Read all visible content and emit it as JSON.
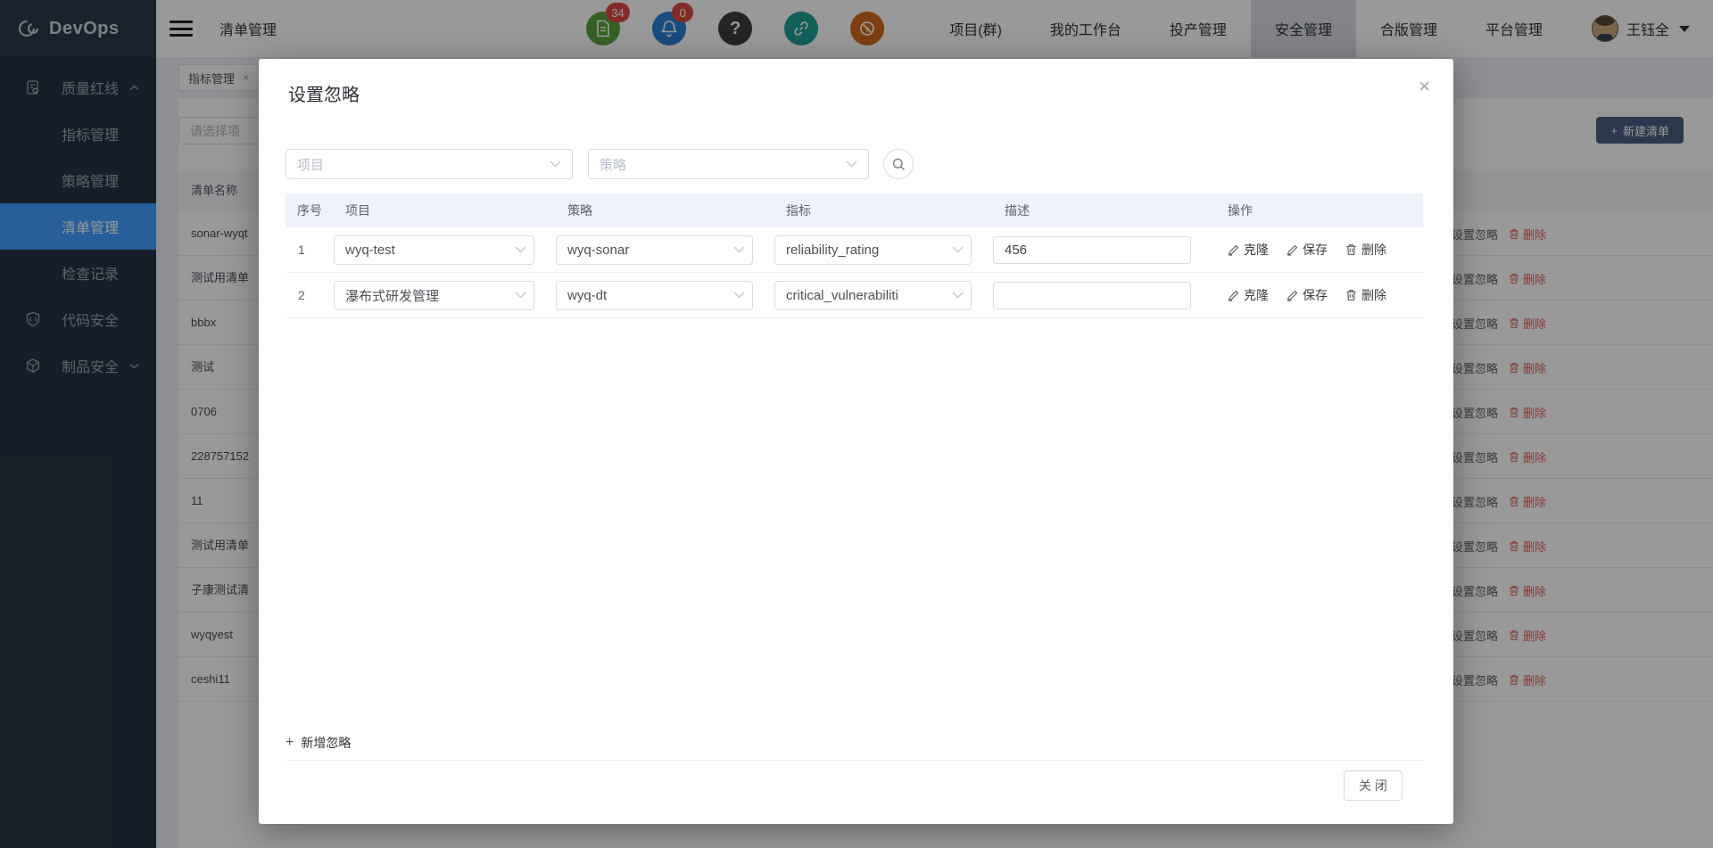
{
  "app": {
    "logo_text": "DevOps"
  },
  "icons": {
    "close": "×",
    "plus": "+",
    "help": "?"
  },
  "colors": {
    "accent_blue": "#409eff",
    "sidebar_bg": "#263345",
    "delete_red": "#f56c6c",
    "badge_red": "#d94a42",
    "icon_green": "#5ba23c",
    "icon_blue": "#2a7fd4",
    "icon_teal": "#1f9e96",
    "icon_orange": "#d2691e",
    "new_button_navy": "#485e80",
    "modal_table_header_bg": "#eef2fb"
  },
  "sidebar": {
    "items": [
      {
        "label": "质量红线"
      },
      {
        "label": "指标管理"
      },
      {
        "label": "策略管理"
      },
      {
        "label": "清单管理"
      },
      {
        "label": "检查记录"
      },
      {
        "label": "代码安全"
      },
      {
        "label": "制品安全"
      }
    ]
  },
  "header": {
    "page_title": "清单管理",
    "doc_badge": "34",
    "bell_badge": "0",
    "nav": [
      {
        "label": "项目(群)"
      },
      {
        "label": "我的工作台"
      },
      {
        "label": "投产管理"
      },
      {
        "label": "安全管理"
      },
      {
        "label": "合版管理"
      },
      {
        "label": "平台管理"
      }
    ],
    "user_name": "王钰全"
  },
  "page": {
    "tab_label": "指标管理",
    "search_placeholder": "请选择项",
    "new_list_button": "新建清单",
    "list_header": "清单名称",
    "rows": [
      {
        "name": "sonar-wyqt"
      },
      {
        "name": "测试用清单"
      },
      {
        "name": "bbbx"
      },
      {
        "name": "测试"
      },
      {
        "name": "0706"
      },
      {
        "name": "228757152"
      },
      {
        "name": "11"
      },
      {
        "name": "测试用清单"
      },
      {
        "name": "子康测试清"
      },
      {
        "name": "wyqyest"
      },
      {
        "name": "ceshi11"
      }
    ],
    "row_action_ignore": "设置忽略",
    "row_action_delete": "删除"
  },
  "modal": {
    "title": "设置忽略",
    "project_filter_placeholder": "项目",
    "policy_filter_placeholder": "策略",
    "columns": [
      "序号",
      "项目",
      "策略",
      "指标",
      "描述",
      "操作"
    ],
    "rows": [
      {
        "index": "1",
        "project": "wyq-test",
        "policy": "wyq-sonar",
        "metric": "reliability_rating",
        "description": "456"
      },
      {
        "index": "2",
        "project": "瀑布式研发管理",
        "policy": "wyq-dt",
        "metric": "critical_vulnerabiliti",
        "description": ""
      }
    ],
    "action_clone": "克隆",
    "action_save": "保存",
    "action_delete": "删除",
    "add_ignore": "新增忽略",
    "close_button": "关 闭"
  }
}
